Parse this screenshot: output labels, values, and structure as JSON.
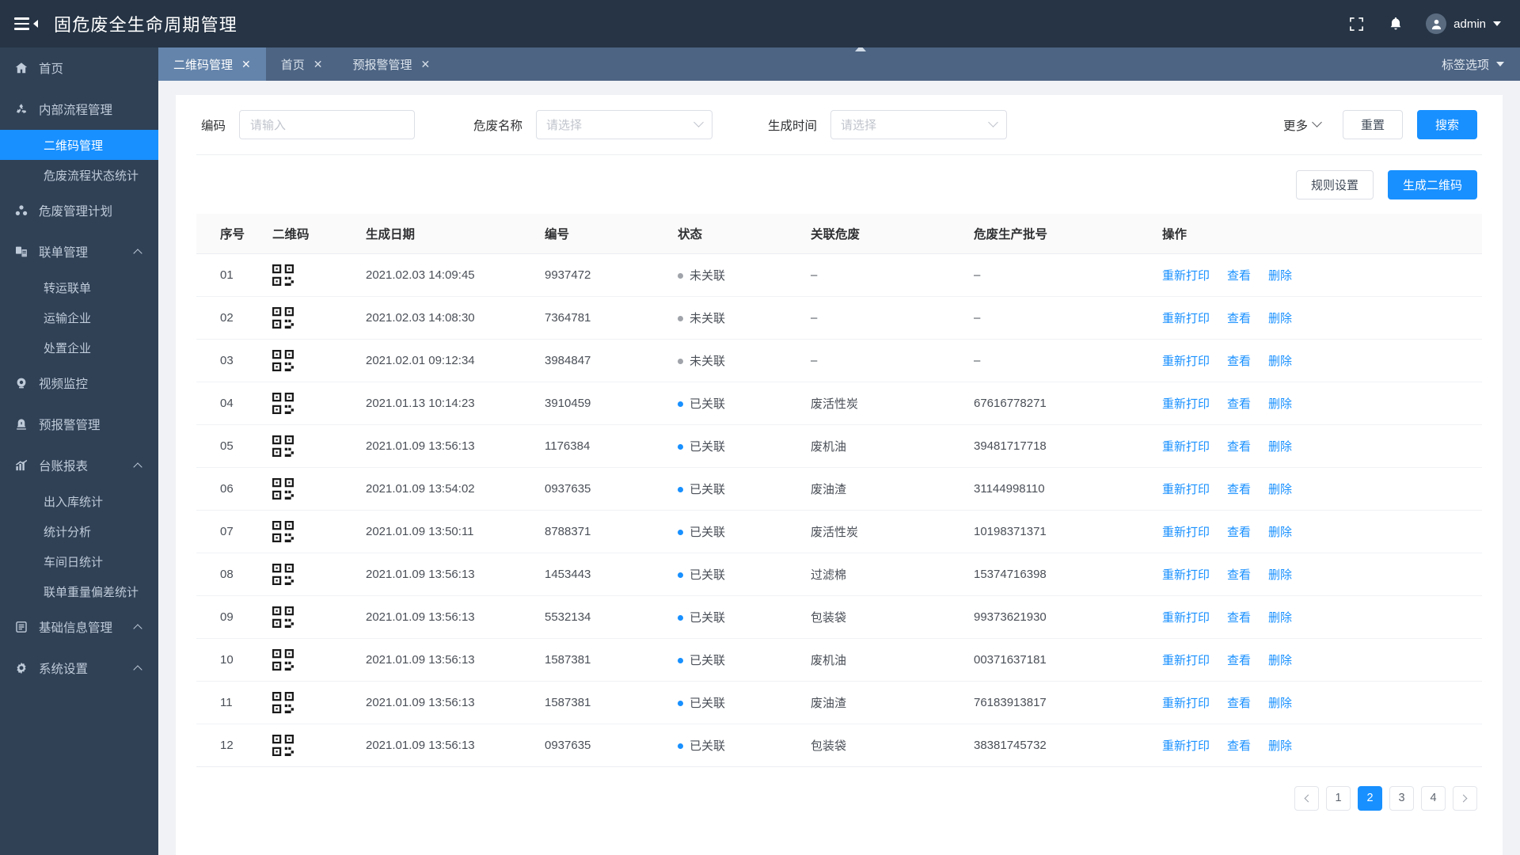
{
  "header": {
    "title": "固危废全生命周期管理",
    "menu_icon": "hamburger-collapse-icon",
    "fullscreen_icon": "fullscreen-icon",
    "bell_icon": "bell-icon",
    "user_icon": "user-avatar-icon",
    "user_name": "admin"
  },
  "sidebar": {
    "items": [
      {
        "label": "首页",
        "icon": "home-icon",
        "type": "top",
        "active": false,
        "chevron": false
      },
      {
        "label": "内部流程管理",
        "icon": "recycle-icon",
        "type": "top",
        "active": false,
        "chevron": false
      },
      {
        "label": "二维码管理",
        "icon": "",
        "type": "sub",
        "active": true,
        "chevron": false
      },
      {
        "label": "危废流程状态统计",
        "icon": "",
        "type": "sub",
        "active": false,
        "chevron": false
      },
      {
        "label": "危废管理计划",
        "icon": "molecule-icon",
        "type": "top",
        "active": false,
        "chevron": false
      },
      {
        "label": "联单管理",
        "icon": "documents-icon",
        "type": "top",
        "active": false,
        "chevron": true
      },
      {
        "label": "转运联单",
        "icon": "",
        "type": "sub",
        "active": false,
        "chevron": false
      },
      {
        "label": "运输企业",
        "icon": "",
        "type": "sub",
        "active": false,
        "chevron": false
      },
      {
        "label": "处置企业",
        "icon": "",
        "type": "sub",
        "active": false,
        "chevron": false
      },
      {
        "label": "视频监控",
        "icon": "camera-icon",
        "type": "top",
        "active": false,
        "chevron": false
      },
      {
        "label": "预报警管理",
        "icon": "alarm-icon",
        "type": "top",
        "active": false,
        "chevron": false
      },
      {
        "label": "台账报表",
        "icon": "chart-icon",
        "type": "top",
        "active": false,
        "chevron": true
      },
      {
        "label": "出入库统计",
        "icon": "",
        "type": "sub",
        "active": false,
        "chevron": false
      },
      {
        "label": "统计分析",
        "icon": "",
        "type": "sub",
        "active": false,
        "chevron": false
      },
      {
        "label": "车间日统计",
        "icon": "",
        "type": "sub",
        "active": false,
        "chevron": false
      },
      {
        "label": "联单重量偏差统计",
        "icon": "",
        "type": "sub",
        "active": false,
        "chevron": false
      },
      {
        "label": "基础信息管理",
        "icon": "list-icon",
        "type": "top",
        "active": false,
        "chevron": true
      },
      {
        "label": "系统设置",
        "icon": "gear-icon",
        "type": "top",
        "active": false,
        "chevron": true
      }
    ]
  },
  "tabbar": {
    "tabs": [
      {
        "label": "二维码管理",
        "active": true
      },
      {
        "label": "首页",
        "active": false
      },
      {
        "label": "预报警管理",
        "active": false
      }
    ],
    "close_glyph": "✕",
    "right_label": "标签选项",
    "collapse_icon": "collapse-up-icon"
  },
  "filters": {
    "code": {
      "label": "编码",
      "placeholder": "请输入",
      "value": ""
    },
    "waste_name": {
      "label": "危废名称",
      "placeholder": "请选择",
      "value": ""
    },
    "create_time": {
      "label": "生成时间",
      "placeholder": "请选择",
      "value": ""
    },
    "more_label": "更多",
    "reset_label": "重置",
    "search_label": "搜索"
  },
  "actions": {
    "rule_settings_label": "规则设置",
    "generate_qr_label": "生成二维码"
  },
  "table": {
    "columns": [
      "序号",
      "二维码",
      "生成日期",
      "编号",
      "状态",
      "关联危废",
      "危废生产批号",
      "操作"
    ],
    "row_actions": [
      "重新打印",
      "查看",
      "删除"
    ],
    "rows": [
      {
        "seq": "01",
        "qr": "qr-code-icon",
        "date": "2021.02.03  14:09:45",
        "no": "9937472",
        "state": "未关联",
        "state_type": "unlinked",
        "waste": "–",
        "batch": "–"
      },
      {
        "seq": "02",
        "qr": "qr-code-icon",
        "date": "2021.02.03  14:08:30",
        "no": "7364781",
        "state": "未关联",
        "state_type": "unlinked",
        "waste": "–",
        "batch": "–"
      },
      {
        "seq": "03",
        "qr": "qr-code-icon",
        "date": "2021.02.01  09:12:34",
        "no": "3984847",
        "state": "未关联",
        "state_type": "unlinked",
        "waste": "–",
        "batch": "–"
      },
      {
        "seq": "04",
        "qr": "qr-code-icon",
        "date": "2021.01.13  10:14:23",
        "no": "3910459",
        "state": "已关联",
        "state_type": "linked",
        "waste": "废活性炭",
        "batch": "67616778271"
      },
      {
        "seq": "05",
        "qr": "qr-code-icon",
        "date": "2021.01.09  13:56:13",
        "no": "1176384",
        "state": "已关联",
        "state_type": "linked",
        "waste": "废机油",
        "batch": "39481717718"
      },
      {
        "seq": "06",
        "qr": "qr-code-icon",
        "date": "2021.01.09  13:54:02",
        "no": "0937635",
        "state": "已关联",
        "state_type": "linked",
        "waste": "废油渣",
        "batch": "31144998110"
      },
      {
        "seq": "07",
        "qr": "qr-code-icon",
        "date": "2021.01.09  13:50:11",
        "no": "8788371",
        "state": "已关联",
        "state_type": "linked",
        "waste": "废活性炭",
        "batch": "10198371371"
      },
      {
        "seq": "08",
        "qr": "qr-code-icon",
        "date": "2021.01.09  13:56:13",
        "no": "1453443",
        "state": "已关联",
        "state_type": "linked",
        "waste": "过滤棉",
        "batch": "15374716398"
      },
      {
        "seq": "09",
        "qr": "qr-code-icon",
        "date": "2021.01.09  13:56:13",
        "no": "5532134",
        "state": "已关联",
        "state_type": "linked",
        "waste": "包装袋",
        "batch": "99373621930"
      },
      {
        "seq": "10",
        "qr": "qr-code-icon",
        "date": "2021.01.09  13:56:13",
        "no": "1587381",
        "state": "已关联",
        "state_type": "linked",
        "waste": "废机油",
        "batch": "00371637181"
      },
      {
        "seq": "11",
        "qr": "qr-code-icon",
        "date": "2021.01.09  13:56:13",
        "no": "1587381",
        "state": "已关联",
        "state_type": "linked",
        "waste": "废油渣",
        "batch": "76183913817"
      },
      {
        "seq": "12",
        "qr": "qr-code-icon",
        "date": "2021.01.09  13:56:13",
        "no": "0937635",
        "state": "已关联",
        "state_type": "linked",
        "waste": "包装袋",
        "batch": "38381745732"
      }
    ]
  },
  "pagination": {
    "prev_icon": "chevron-left-icon",
    "next_icon": "chevron-right-icon",
    "pages": [
      "1",
      "2",
      "3",
      "4"
    ],
    "current": "2"
  },
  "colors": {
    "accent": "#1890ff",
    "sidebar_bg": "#304156",
    "header_bg": "#263445",
    "tabbar_bg": "#4d6483",
    "tab_active_bg": "#6484ab",
    "status_unlinked": "#a0a4aa",
    "status_linked": "#1890ff"
  }
}
